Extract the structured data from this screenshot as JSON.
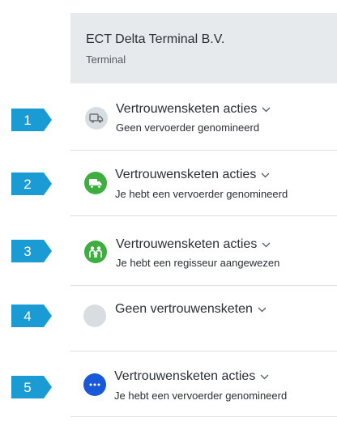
{
  "header": {
    "title": "ECT Delta Terminal B.V.",
    "subtitle": "Terminal"
  },
  "rows": [
    {
      "number": "1",
      "icon": "truck-icon",
      "state": "grey",
      "label": "Vertrouwensketen acties",
      "sub": "Geen vervoerder genomineerd"
    },
    {
      "number": "2",
      "icon": "truck-icon",
      "state": "green",
      "label": "Vertrouwensketen acties",
      "sub": "Je hebt een vervoerder genomineerd"
    },
    {
      "number": "3",
      "icon": "people-icon",
      "state": "green",
      "label": "Vertrouwensketen acties",
      "sub": "Je hebt een regisseur aangewezen"
    },
    {
      "number": "4",
      "icon": "empty-circle-icon",
      "state": "grey",
      "label": "Geen vertrouwensketen",
      "sub": ""
    },
    {
      "number": "5",
      "icon": "more-icon",
      "state": "blue",
      "label": "Vertrouwensketen acties",
      "sub": "Je hebt een vervoerder genomineerd"
    }
  ],
  "colors": {
    "badge": "#1a9bd4",
    "green": "#3dae3f",
    "grey": "#d8dde2",
    "blue": "#1958d8",
    "header_bg": "#e7eaed"
  }
}
